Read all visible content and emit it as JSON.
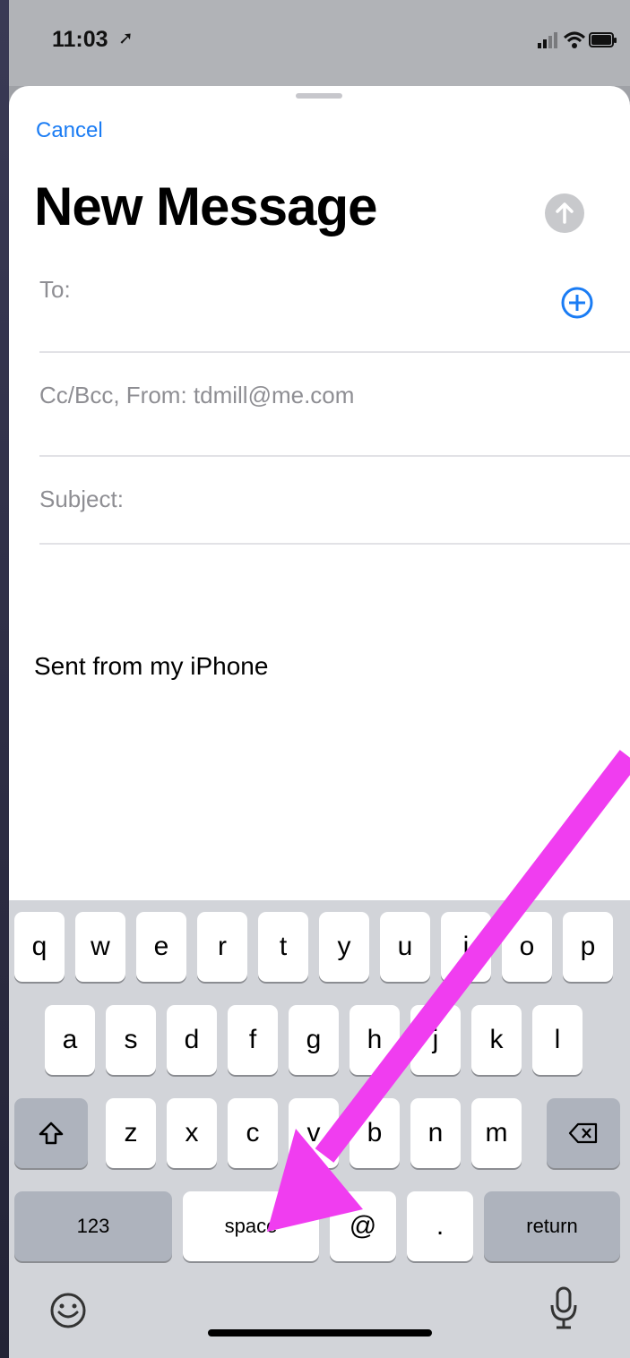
{
  "status": {
    "time": "11:03",
    "location_glyph": "➚",
    "icons": [
      "signal-icon",
      "wifi-icon",
      "battery-icon"
    ]
  },
  "sheet": {
    "cancel": "Cancel",
    "title": "New Message",
    "to_label": "To:",
    "cc_label": "Cc/Bcc, From: tdmill@me.com",
    "subject_label": "Subject:",
    "body_text": "Sent from my iPhone"
  },
  "keyboard": {
    "row1": [
      "q",
      "w",
      "e",
      "r",
      "t",
      "y",
      "u",
      "i",
      "o",
      "p"
    ],
    "row2": [
      "a",
      "s",
      "d",
      "f",
      "g",
      "h",
      "j",
      "k",
      "l"
    ],
    "row3": [
      "z",
      "x",
      "c",
      "v",
      "b",
      "n",
      "m"
    ],
    "mode_key": "123",
    "space_key": "space",
    "at_key": "@",
    "period_key": ".",
    "return_key": "return"
  },
  "colors": {
    "accent": "#1a7cf4",
    "annotation": "#f03df0",
    "keyboard": "#d2d4d9"
  }
}
